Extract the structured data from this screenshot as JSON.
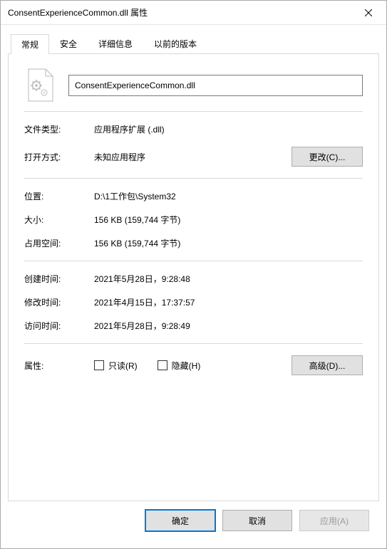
{
  "window": {
    "title": "ConsentExperienceCommon.dll 属性"
  },
  "tabs": {
    "general": "常规",
    "security": "安全",
    "details": "详细信息",
    "previous": "以前的版本"
  },
  "general": {
    "filename": "ConsentExperienceCommon.dll",
    "file_type_label": "文件类型:",
    "file_type_value": "应用程序扩展 (.dll)",
    "open_with_label": "打开方式:",
    "open_with_value": "未知应用程序",
    "change_button": "更改(C)...",
    "location_label": "位置:",
    "location_value": "D:\\1工作包\\System32",
    "size_label": "大小:",
    "size_value": "156 KB (159,744 字节)",
    "size_on_disk_label": "占用空间:",
    "size_on_disk_value": "156 KB (159,744 字节)",
    "created_label": "创建时间:",
    "created_value": "2021年5月28日，9:28:48",
    "modified_label": "修改时间:",
    "modified_value": "2021年4月15日，17:37:57",
    "accessed_label": "访问时间:",
    "accessed_value": "2021年5月28日，9:28:49",
    "attributes_label": "属性:",
    "readonly_label": "只读(R)",
    "hidden_label": "隐藏(H)",
    "advanced_button": "高级(D)..."
  },
  "footer": {
    "ok": "确定",
    "cancel": "取消",
    "apply": "应用(A)"
  }
}
